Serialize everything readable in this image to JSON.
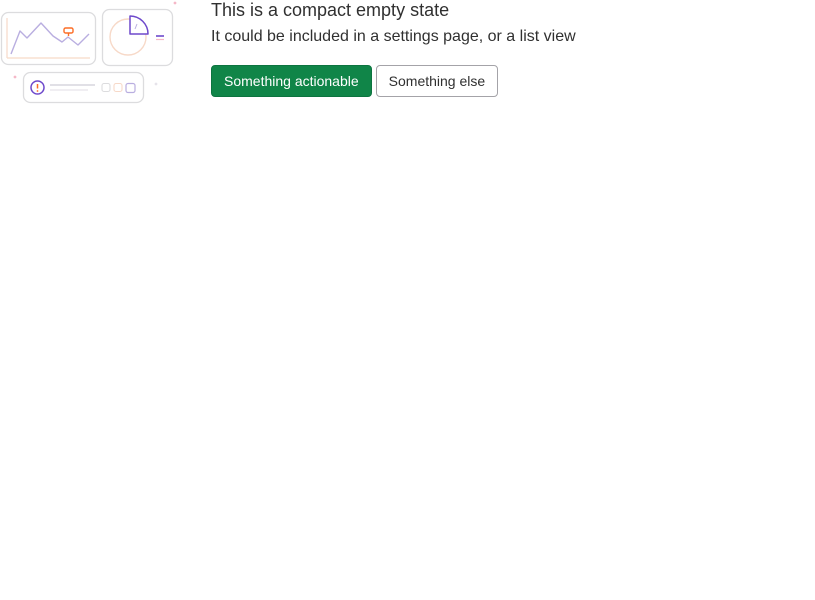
{
  "empty_state": {
    "title": "This is a compact empty state",
    "description": "It could be included in a settings page, or a list view",
    "primary_action": "Something actionable",
    "secondary_action": "Something else",
    "illustration": "empty-state-illustration"
  },
  "colors": {
    "primary_button": "#108548",
    "illustration_purple": "#6e49cb",
    "illustration_orange": "#fc6d26",
    "illustration_border": "#dcdcde"
  }
}
